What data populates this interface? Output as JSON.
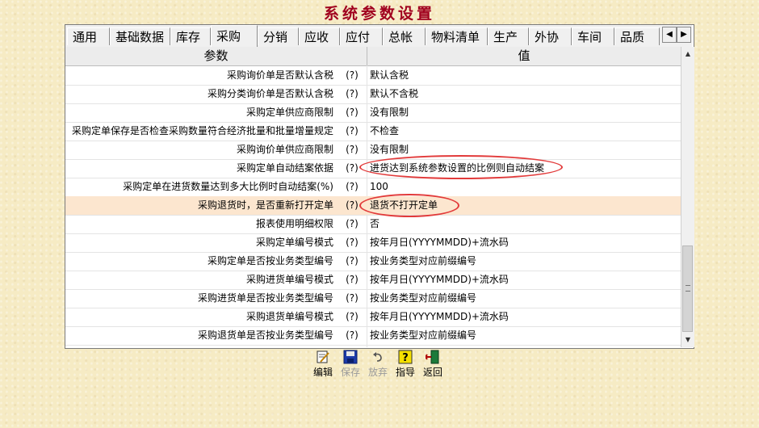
{
  "window_title": "系统参数设置",
  "tabs": [
    "通用",
    "基础数据",
    "库存",
    "采购",
    "分销",
    "应收",
    "应付",
    "总帐",
    "物料清单",
    "生产",
    "外协",
    "车间",
    "品质"
  ],
  "active_tab": "采购",
  "tab_scroll": {
    "left": "◀",
    "right": "▶"
  },
  "grid": {
    "headers": {
      "param": "参数",
      "value": "值"
    },
    "rows": [
      {
        "param": "采购询价单是否默认含税",
        "help": "(?)",
        "value": "默认含税"
      },
      {
        "param": "采购分类询价单是否默认含税",
        "help": "(?)",
        "value": "默认不含税"
      },
      {
        "param": "采购定单供应商限制",
        "help": "(?)",
        "value": "没有限制"
      },
      {
        "param": "采购定单保存是否检查采购数量符合经济批量和批量增量规定",
        "help": "(?)",
        "value": "不检查"
      },
      {
        "param": "采购询价单供应商限制",
        "help": "(?)",
        "value": "没有限制"
      },
      {
        "param": "采购定单自动结案依据",
        "help": "(?)",
        "value": "进货达到系统参数设置的比例则自动结案"
      },
      {
        "param": "采购定单在进货数量达到多大比例时自动结案(%)",
        "help": "(?)",
        "value": "100"
      },
      {
        "param": "采购退货时，是否重新打开定单",
        "help": "(?)",
        "value": "退货不打开定单"
      },
      {
        "param": "报表使用明细权限",
        "help": "(?)",
        "value": "否"
      },
      {
        "param": "采购定单编号模式",
        "help": "(?)",
        "value": "按年月日(YYYYMMDD)+流水码"
      },
      {
        "param": "采购定单是否按业务类型编号",
        "help": "(?)",
        "value": "按业务类型对应前缀编号"
      },
      {
        "param": "采购进货单编号模式",
        "help": "(?)",
        "value": "按年月日(YYYYMMDD)+流水码"
      },
      {
        "param": "采购进货单是否按业务类型编号",
        "help": "(?)",
        "value": "按业务类型对应前缀编号"
      },
      {
        "param": "采购退货单编号模式",
        "help": "(?)",
        "value": "按年月日(YYYYMMDD)+流水码"
      },
      {
        "param": "采购退货单是否按业务类型编号",
        "help": "(?)",
        "value": "按业务类型对应前缀编号"
      }
    ],
    "selected_row": 7
  },
  "toolbar": {
    "edit": "编辑",
    "save": "保存",
    "discard": "放弃",
    "guide": "指导",
    "back": "返回"
  },
  "colors": {
    "title": "#a0001e",
    "selected_row": "#fce6cf",
    "annotation": "#e23a3a",
    "background": "#f6ebc4"
  }
}
